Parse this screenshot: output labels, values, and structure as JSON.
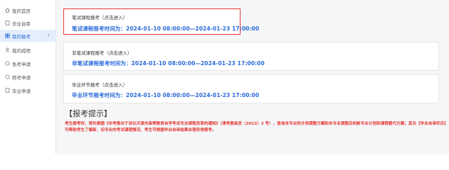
{
  "sidebar": {
    "items": [
      {
        "label": "我的首页",
        "icon": "home-icon",
        "active": false
      },
      {
        "label": "毕业自审",
        "icon": "document-icon",
        "active": false
      },
      {
        "label": "我的报考",
        "icon": "grid-icon",
        "active": true
      },
      {
        "label": "我的成绩",
        "icon": "user-icon",
        "active": false
      },
      {
        "label": "免考申请",
        "icon": "circle-icon",
        "active": false
      },
      {
        "label": "转考申请",
        "icon": "circle-icon",
        "active": false
      },
      {
        "label": "毕业申请",
        "icon": "document-icon",
        "active": false
      }
    ]
  },
  "cards": [
    {
      "title": "笔试课程报考（点击进入）",
      "time": "笔试课程报考时间为：2024-01-10 08:00:00—2024-01-23 17:00:00"
    },
    {
      "title": "非笔试课程报考（点击进入）",
      "time": "非笔试课程报考时间为：2024-01-10 08:00:00—2024-01-23 17:00:00"
    },
    {
      "title": "毕业环节报考（点击进入）",
      "time": "毕业环节报考时间为：2024-01-10 08:00:00—2024-01-23 17:00:00"
    }
  ],
  "notice": {
    "title": "【报考提示】",
    "text": "考生报考时，首先根据《市考委关于深化天津市高等教育自学考试专业课程改革的通知》（津考委高发〔2023〕3 号），查询本专业的计划调整方案和本专业调整后的新专业计划和课程替代方案；其次【毕业自审栏目】可帮助考生了解新、旧专业的考试课程情况，考生可根据毕业自审结果合理安排报考。"
  },
  "colors": {
    "accent": "#2a6ad9",
    "highlight_border": "#e53935",
    "notice": "#e53935",
    "active_bg": "#e4eefc"
  }
}
